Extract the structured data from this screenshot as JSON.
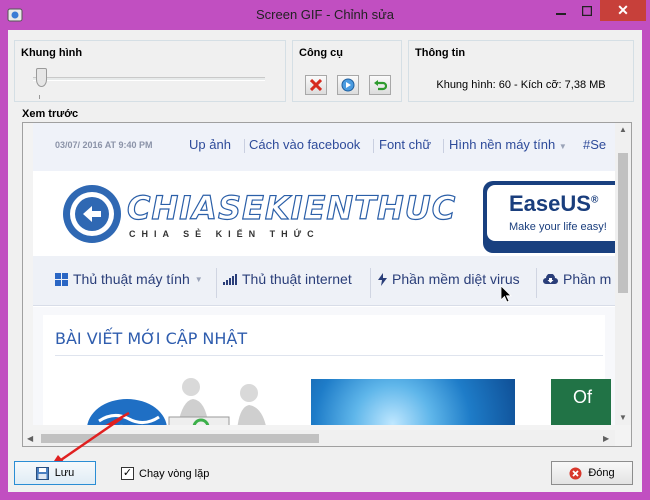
{
  "window": {
    "title": "Screen GIF - Chỉnh sửa",
    "close_glyph": "✕"
  },
  "frame_group": {
    "title": "Khung hình",
    "slider_position": 0
  },
  "tools_group": {
    "title": "Công cụ",
    "buttons": [
      "delete-frame",
      "play",
      "undo"
    ]
  },
  "info_group": {
    "title": "Thông tin",
    "text": "Khung hình: 60 - Kích cỡ: 7,38 MB"
  },
  "preview": {
    "title": "Xem trước",
    "site": {
      "date": "03/07/ 2016 AT 9:40 PM",
      "top_links": [
        "Up ảnh",
        "Cách vào facebook",
        "Font chữ",
        "Hình nền máy tính",
        "#Se"
      ],
      "logo_text": "CHIASEKIENTHUC",
      "logo_sub": "CHIA SẺ KIẾN THỨC",
      "ad_brand": "EaseUS",
      "ad_reg": "®",
      "ad_slogan": "Make your life easy!",
      "nav": [
        "Thủ thuật máy tính",
        "Thủ thuật internet",
        "Phần mềm diệt virus",
        "Phần m"
      ],
      "section_title": "BÀI VIẾT MỚI CẬP NHẬT",
      "office_letters": "Of"
    }
  },
  "footer": {
    "save_label": "Lưu",
    "loop_label": "Chạy vòng lặp",
    "loop_checked": true,
    "close_label": "Đóng"
  }
}
